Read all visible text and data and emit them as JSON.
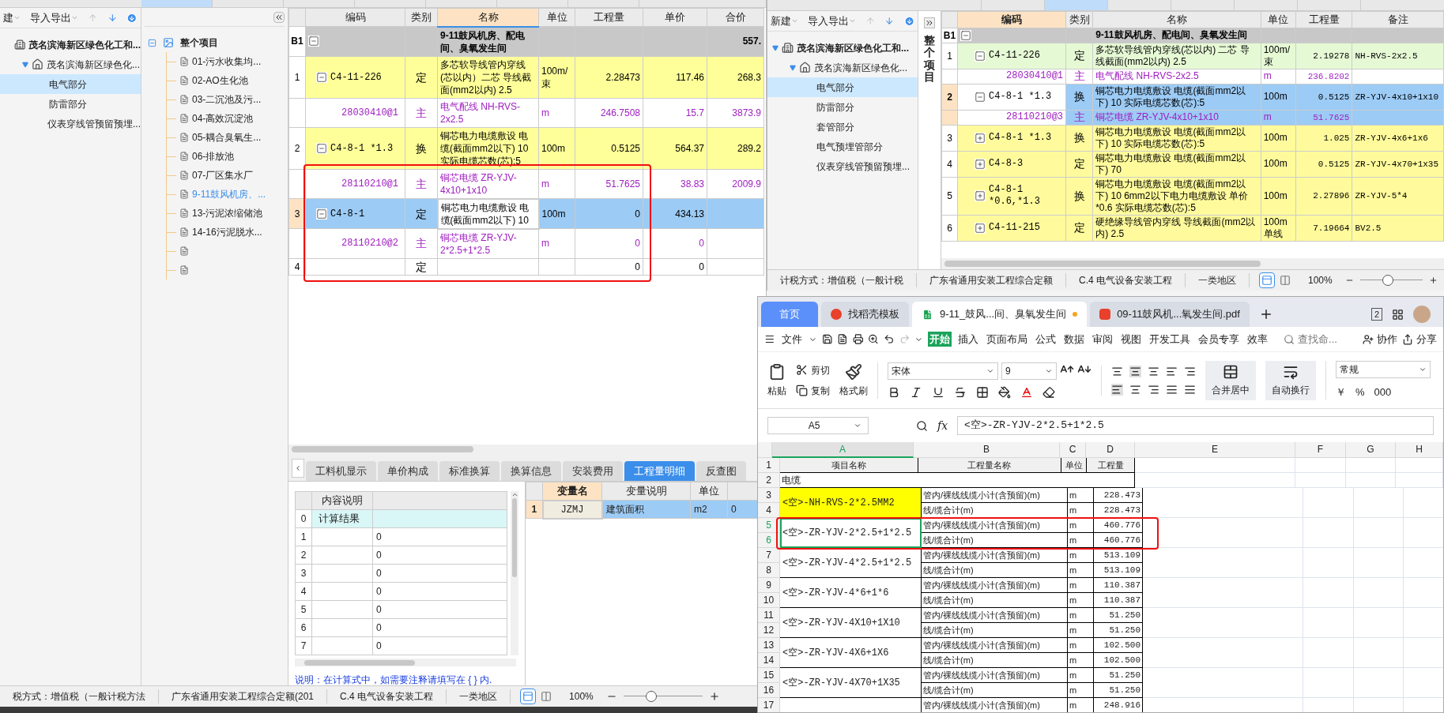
{
  "main_app": {
    "top_tabs": [
      {
        "selected": true
      },
      {
        "selected": false
      },
      {
        "selected": false
      },
      {
        "selected": false
      },
      {
        "selected": false
      },
      {
        "selected": false
      },
      {
        "selected": false
      }
    ],
    "sidebar": {
      "toolbar": [
        {
          "label": "建"
        },
        {
          "label": "导入导出"
        }
      ],
      "tree": [
        {
          "label": "茂名滨海新区绿色化工和...",
          "kind": "building",
          "children": [
            {
              "label": "茂名滨海新区绿色化...",
              "kind": "house",
              "expanded": true,
              "children": [
                {
                  "label": "电气部分",
                  "selected": true
                },
                {
                  "label": "防雷部分",
                  "selected": false
                },
                {
                  "label": "仪表穿线管预留预埋...",
                  "selected": false
                }
              ]
            }
          ]
        }
      ]
    },
    "project_tree": {
      "label": "整个项目",
      "expanded": true,
      "children": [
        {
          "label": "01-污水收集均...",
          "selected": false
        },
        {
          "label": "02-AO生化池",
          "selected": false
        },
        {
          "label": "03-二沉池及污...",
          "selected": false
        },
        {
          "label": "04-高效沉淀池",
          "selected": false
        },
        {
          "label": "05-耦合臭氧生...",
          "selected": false
        },
        {
          "label": "06-排放池",
          "selected": false
        },
        {
          "label": "07-厂区集水厂",
          "selected": false
        },
        {
          "label": "9-11鼓风机房、...",
          "selected": true
        },
        {
          "label": "13-污泥浓缩储池",
          "selected": false
        },
        {
          "label": "14-16污泥脱水...",
          "selected": false
        },
        {
          "selected": false
        },
        {
          "selected": false
        }
      ]
    },
    "table": {
      "columns": [
        {
          "label": "编码",
          "selected": false
        },
        {
          "label": "类别",
          "selected": false
        },
        {
          "label": "名称",
          "selected": true
        },
        {
          "label": "单位",
          "selected": false
        },
        {
          "label": "工程量",
          "selected": false
        },
        {
          "label": "单价",
          "selected": false
        },
        {
          "label": "合价",
          "selected": false
        }
      ],
      "rows": [
        {
          "kind": "section",
          "no": "B1",
          "expanded": true,
          "name": "9-11鼓风机房、配电间、臭氧发生间",
          "total": "557.",
          "selected": false
        },
        {
          "kind": "item",
          "no": "1",
          "code": "C4-11-226",
          "expanded": true,
          "type": "定",
          "name": "多芯软导线管内穿线(芯以内）二芯 导线截面(mm2以内) 2.5",
          "unit": "100m/束",
          "qty": "2.28473",
          "price": "117.46",
          "total": "268.3",
          "selected": false
        },
        {
          "kind": "material",
          "code": "28030410@1",
          "type": "主",
          "name": "电气配线 NH-RVS-2x2.5",
          "unit": "m",
          "qty": "246.7508",
          "price": "15.7",
          "total": "3873.9",
          "selected": false
        },
        {
          "kind": "item",
          "no": "2",
          "code": "C4-8-1 *1.3",
          "expanded": true,
          "type": "换",
          "name": "铜芯电力电缆敷设 电缆(截面mm2以下) 10 实际电缆芯数(芯):5",
          "unit": "100m",
          "qty": "0.5125",
          "price": "564.37",
          "total": "289.2",
          "selected": false
        },
        {
          "kind": "material",
          "code": "28110210@1",
          "type": "主",
          "name": "铜芯电缆 ZR-YJV-4x10+1x10",
          "unit": "m",
          "qty": "51.7625",
          "price": "38.83",
          "total": "2009.9",
          "selected": false
        },
        {
          "kind": "item",
          "no": "3",
          "code": "C4-8-1",
          "expanded": true,
          "type": "定",
          "name": "铜芯电力电缆敷设 电缆(截面mm2以下) 10",
          "unit": "100m",
          "qty": "0",
          "price": "434.13",
          "selected": true
        },
        {
          "kind": "material",
          "code": "28110210@2",
          "type": "主",
          "name": "铜芯电缆 ZR-YJV-2*2.5+1*2.5",
          "unit": "m",
          "qty": "0",
          "price": "0",
          "selected": false
        },
        {
          "kind": "empty",
          "no": "4",
          "type": "定",
          "qty": "0",
          "price": "0",
          "selected": false
        }
      ]
    },
    "bottom_tabs": [
      {
        "label": "工料机显示",
        "selected": false
      },
      {
        "label": "单价构成",
        "selected": false
      },
      {
        "label": "标准换算",
        "selected": false
      },
      {
        "label": "换算信息",
        "selected": false
      },
      {
        "label": "安装费用",
        "selected": false
      },
      {
        "label": "工程量明细",
        "selected": true
      },
      {
        "label": "反查图",
        "selected": false
      }
    ],
    "calc_grid": {
      "column": "内容说明",
      "rows": [
        {
          "no": "0",
          "label": "计算结果",
          "selected": true
        },
        {
          "no": "1",
          "value": "0",
          "selected": false
        },
        {
          "no": "2",
          "value": "0",
          "selected": false
        },
        {
          "no": "3",
          "value": "0",
          "selected": false
        },
        {
          "no": "4",
          "value": "0",
          "selected": false
        },
        {
          "no": "5",
          "value": "0",
          "selected": false
        },
        {
          "no": "6",
          "value": "0",
          "selected": false
        },
        {
          "no": "7",
          "value": "0",
          "selected": false
        }
      ]
    },
    "note": "说明：在计算式中，如需要注释请填写在 { } 内.",
    "variable_grid": {
      "columns": [
        {
          "label": "变量名",
          "selected": true
        },
        {
          "label": "变量说明",
          "selected": false
        },
        {
          "label": "单位",
          "selected": false
        }
      ],
      "rows": [
        {
          "no": "1",
          "cells": [
            "JZMJ",
            "建筑面积",
            "m2",
            "0"
          ],
          "selected": true
        }
      ]
    },
    "status_bar": {
      "items": [
        "税方式：增值税（一般计税方法",
        "广东省通用安装工程综合定额(201",
        "C.4 电气设备安装工程",
        "一类地区"
      ],
      "view_modes": [
        {
          "selected": true
        },
        {
          "selected": false
        }
      ],
      "zoom": "100%",
      "level": 0.35
    }
  },
  "second_app": {
    "top_tabs": [
      {
        "selected": false
      },
      {
        "selected": false
      },
      {
        "selected": true
      },
      {
        "selected": false
      },
      {
        "selected": false
      },
      {
        "selected": false
      },
      {
        "selected": false
      }
    ],
    "sidebar": {
      "toolbar": [
        {
          "label": "新建"
        },
        {
          "label": "导入导出"
        }
      ],
      "tree": [
        {
          "label": "茂名滨海新区绿色化工和...",
          "kind": "building",
          "expanded": true,
          "children": [
            {
              "label": "茂名滨海新区绿色化...",
              "kind": "house",
              "expanded": true,
              "children": [
                {
                  "label": "电气部分",
                  "selected": true
                },
                {
                  "label": "防雷部分",
                  "selected": false
                },
                {
                  "label": "套管部分",
                  "selected": false
                },
                {
                  "label": "电气预埋管部分",
                  "selected": false
                },
                {
                  "label": "仪表穿线管预留预埋...",
                  "selected": false
                }
              ]
            }
          ]
        }
      ]
    },
    "side_strip": "整个项目",
    "table": {
      "columns": [
        {
          "label": "编码",
          "selected": true
        },
        {
          "label": "类别",
          "selected": false
        },
        {
          "label": "名称",
          "selected": false
        },
        {
          "label": "单位",
          "selected": false
        },
        {
          "label": "工程量",
          "selected": false
        },
        {
          "label": "备注",
          "selected": false
        }
      ],
      "rows": [
        {
          "kind": "section",
          "no": "B1",
          "expanded": true,
          "name": "9-11鼓风机房、配电间、臭氧发生间",
          "selected": false
        },
        {
          "kind": "item",
          "no": "1",
          "code": "C4-11-226",
          "expanded": true,
          "type": "定",
          "name": "多芯软导线管内穿线(芯以内) 二芯 导线截面(mm2以内) 2.5",
          "unit": "100m/束",
          "qty": "2.19278",
          "note": "NH-RVS-2x2.5",
          "color": "#e6f9d5",
          "selected": false
        },
        {
          "kind": "material",
          "code": "28030410@1",
          "type": "主",
          "name": "电气配线 NH-RVS-2x2.5",
          "unit": "m",
          "qty": "236.8202",
          "selected": false
        },
        {
          "kind": "item",
          "no": "2",
          "code": "C4-8-1 *1.3",
          "expanded": true,
          "type": "换",
          "name": "铜芯电力电缆敷设 电缆(截面mm2以下) 10  实际电缆芯数(芯):5",
          "unit": "100m",
          "qty": "0.5125",
          "note": "ZR-YJV-4x10+1x10",
          "selected": true
        },
        {
          "kind": "material",
          "code": "28110210@3",
          "type": "主",
          "name": "铜芯电缆 ZR-YJV-4x10+1x10",
          "unit": "m",
          "qty": "51.7625",
          "selected": true
        },
        {
          "kind": "item",
          "no": "3",
          "code": "C4-8-1 *1.3",
          "expanded": false,
          "type": "换",
          "name": "铜芯电力电缆敷设 电缆(截面mm2以下) 10  实际电缆芯数(芯):5",
          "unit": "100m",
          "qty": "1.025",
          "note": "ZR-YJV-4x6+1x6",
          "color": "#fffb9c",
          "selected": false
        },
        {
          "kind": "item",
          "no": "4",
          "code": "C4-8-3",
          "expanded": false,
          "type": "定",
          "name": "铜芯电力电缆敷设 电缆(截面mm2以下) 70",
          "unit": "100m",
          "qty": "0.5125",
          "note": "ZR-YJV-4x70+1x35",
          "color": "#fffb9c",
          "selected": false
        },
        {
          "kind": "item",
          "no": "5",
          "code": "C4-8-1 *0.6,*1.3",
          "expanded": false,
          "type": "换",
          "name": "铜芯电力电缆敷设 电缆(截面mm2以下) 10  6mm2以下电力电缆敷设 单价*0.6 实际电缆芯数(芯):5",
          "unit": "100m",
          "qty": "2.27896",
          "note": "ZR-YJV-5*4",
          "color": "#fffb9c",
          "selected": false
        },
        {
          "kind": "item",
          "no": "6",
          "code": "C4-11-215",
          "expanded": false,
          "type": "定",
          "name": "硬绝缘导线管内穿线 导线截面(mm2以内) 2.5",
          "unit": "100m单线",
          "qty": "7.19664",
          "note": "BV2.5",
          "color": "#fffb9c",
          "selected": false
        }
      ]
    },
    "status_bar": {
      "items": [
        "计税方式：增值税（一般计税",
        "广东省通用安装工程综合定额",
        "C.4 电气设备安装工程",
        "一类地区"
      ],
      "view_modes": [
        {
          "selected": true
        },
        {
          "selected": false
        }
      ],
      "zoom": "100%",
      "level": 0.45
    }
  },
  "spreadsheet": {
    "tabs": [
      {
        "label": "首页",
        "kind": "home",
        "selected": false
      },
      {
        "label": "找稻壳模板",
        "kind": "template",
        "selected": false
      },
      {
        "label": "9-11_鼓风...间、臭氧发生间",
        "kind": "sheet",
        "selected": true
      },
      {
        "label": "09-11鼓风机...氧发生间.pdf",
        "kind": "pdf",
        "selected": false
      }
    ],
    "window_count": "2",
    "menu": [
      {
        "label": "文件",
        "selected": false
      },
      {
        "label": "开始",
        "selected": true
      },
      {
        "label": "插入",
        "selected": false
      },
      {
        "label": "页面布局",
        "selected": false
      },
      {
        "label": "公式",
        "selected": false
      },
      {
        "label": "数据",
        "selected": false
      },
      {
        "label": "审阅",
        "selected": false
      },
      {
        "label": "视图",
        "selected": false
      },
      {
        "label": "开发工具",
        "selected": false
      },
      {
        "label": "会员专享",
        "selected": false
      },
      {
        "label": "效率",
        "selected": false
      }
    ],
    "search": {
      "placeholder": "查找命..."
    },
    "actions": [
      "协作",
      "分享"
    ],
    "ribbon": {
      "paste": "粘贴",
      "cut": "剪切",
      "copy": "复制",
      "format_painter": "格式刷",
      "font": "宋体",
      "size": "9",
      "merge": "合并居中",
      "wrap": "自动换行",
      "number_format": "常规",
      "number_buttons": [
        "￥",
        "%",
        "000"
      ]
    },
    "formula_bar": {
      "cell": "A5",
      "fx": "fx",
      "value": "<空>-ZR-YJV-2*2.5+1*2.5"
    },
    "columns": [
      {
        "label": "A",
        "selected": true
      },
      {
        "label": "B",
        "selected": false
      },
      {
        "label": "C",
        "selected": false
      },
      {
        "label": "D",
        "selected": false
      },
      {
        "label": "E",
        "selected": false
      },
      {
        "label": "F",
        "selected": false
      },
      {
        "label": "G",
        "selected": false
      },
      {
        "label": "H",
        "selected": false
      }
    ],
    "header_row": {
      "no": "1",
      "cells": [
        "项目名称",
        "工程量名称",
        "单位",
        "工程量"
      ]
    },
    "title_row": {
      "no": "2",
      "text": "电缆"
    },
    "groups": [
      {
        "name": "<空>-NH-RVS-2*2.5MM2",
        "highlight": true,
        "selected": false,
        "lines": [
          {
            "no": "3",
            "desc": "管内/裸线线缆小计(含预留)(m)",
            "unit": "m",
            "qty": "228.473"
          },
          {
            "no": "4",
            "desc": "线/缆合计(m)",
            "unit": "m",
            "qty": "228.473"
          }
        ]
      },
      {
        "name": "<空>-ZR-YJV-2*2.5+1*2.5",
        "highlight": false,
        "selected": true,
        "lines": [
          {
            "no": "5",
            "desc": "管内/裸线线缆小计(含预留)(m)",
            "unit": "m",
            "qty": "460.776"
          },
          {
            "no": "6",
            "desc": "线/缆合计(m)",
            "unit": "m",
            "qty": "460.776"
          }
        ]
      },
      {
        "name": "<空>-ZR-YJV-4*2.5+1*2.5",
        "highlight": false,
        "selected": false,
        "lines": [
          {
            "no": "7",
            "desc": "管内/裸线线缆小计(含预留)(m)",
            "unit": "m",
            "qty": "513.109"
          },
          {
            "no": "8",
            "desc": "线/缆合计(m)",
            "unit": "m",
            "qty": "513.109"
          }
        ]
      },
      {
        "name": "<空>-ZR-YJV-4*6+1*6",
        "highlight": false,
        "selected": false,
        "lines": [
          {
            "no": "9",
            "desc": "管内/裸线线缆小计(含预留)(m)",
            "unit": "m",
            "qty": "110.387"
          },
          {
            "no": "10",
            "desc": "线/缆合计(m)",
            "unit": "m",
            "qty": "110.387"
          }
        ]
      },
      {
        "name": "<空>-ZR-YJV-4X10+1X10",
        "highlight": false,
        "selected": false,
        "lines": [
          {
            "no": "11",
            "desc": "管内/裸线线缆小计(含预留)(m)",
            "unit": "m",
            "qty": "51.250"
          },
          {
            "no": "12",
            "desc": "线/缆合计(m)",
            "unit": "m",
            "qty": "51.250"
          }
        ]
      },
      {
        "name": "<空>-ZR-YJV-4X6+1X6",
        "highlight": false,
        "selected": false,
        "lines": [
          {
            "no": "13",
            "desc": "管内/裸线线缆小计(含预留)(m)",
            "unit": "m",
            "qty": "102.500"
          },
          {
            "no": "14",
            "desc": "线/缆合计(m)",
            "unit": "m",
            "qty": "102.500"
          }
        ]
      },
      {
        "name": "<空>-ZR-YJV-4X70+1X35",
        "highlight": false,
        "selected": false,
        "lines": [
          {
            "no": "15",
            "desc": "管内/裸线线缆小计(含预留)(m)",
            "unit": "m",
            "qty": "51.250"
          },
          {
            "no": "16",
            "desc": "线/缆合计(m)",
            "unit": "m",
            "qty": "51.250"
          }
        ]
      },
      {
        "highlight": false,
        "selected": false,
        "lines": [
          {
            "no": "17",
            "desc": "管内/裸线线缆小计(含预留)(m)",
            "unit": "m",
            "qty": "248.916"
          }
        ]
      }
    ]
  }
}
